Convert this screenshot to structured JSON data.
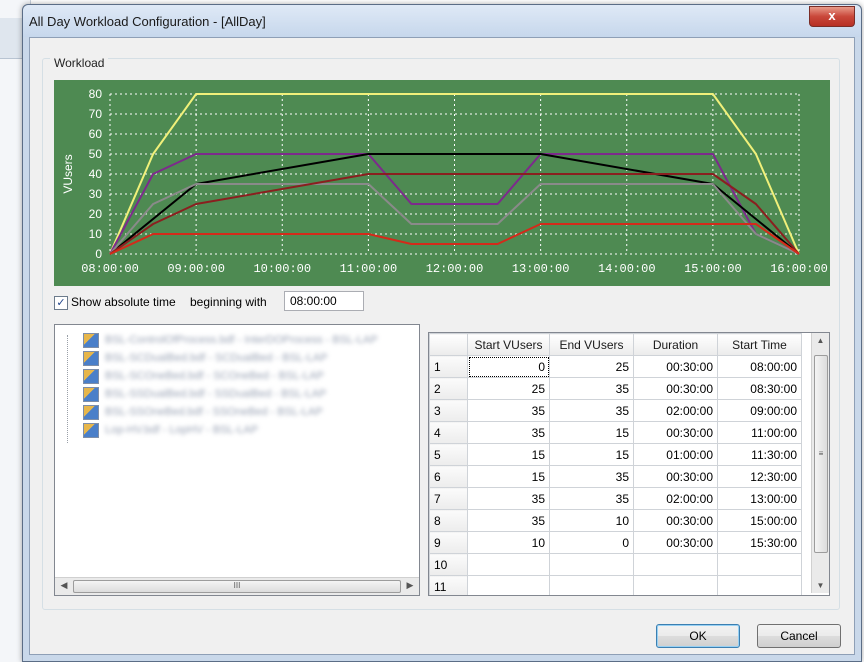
{
  "window": {
    "title": "All Day Workload Configuration - [AllDay]",
    "close_glyph": "x"
  },
  "workload": {
    "group_label": "Workload",
    "show_absolute_time_label_part1": "Show absolute time",
    "show_absolute_time_label_part2": "beginning with",
    "show_absolute_time_checked": true,
    "start_time_value": "08:00:00"
  },
  "chart_data": {
    "type": "line",
    "ylabel": "VUsers",
    "xlabel": "",
    "ylim": [
      0,
      80
    ],
    "y_ticks": [
      "0",
      "10",
      "20",
      "30",
      "40",
      "50",
      "60",
      "70",
      "80"
    ],
    "x_tick_labels": [
      "08:00:00",
      "09:00:00",
      "10:00:00",
      "11:00:00",
      "12:00:00",
      "13:00:00",
      "14:00:00",
      "15:00:00",
      "16:00:00"
    ],
    "x_range_hours": [
      8,
      16
    ],
    "grid": true,
    "background_color": "#4e8a52",
    "series": [
      {
        "color": "#f0f07a",
        "x": [
          8,
          8.5,
          9,
          15,
          15.5,
          16
        ],
        "y": [
          0,
          50,
          80,
          80,
          50,
          0
        ]
      },
      {
        "color": "#7d2a8c",
        "x": [
          8,
          8.5,
          9,
          11,
          11.5,
          12.5,
          13,
          15,
          15.5,
          16
        ],
        "y": [
          0,
          40,
          50,
          50,
          25,
          25,
          50,
          50,
          10,
          0
        ]
      },
      {
        "color": "#000000",
        "x": [
          8,
          9,
          11,
          13,
          15,
          16
        ],
        "y": [
          0,
          35,
          50,
          50,
          35,
          0
        ]
      },
      {
        "color": "#8a8a8a",
        "x": [
          8,
          8.5,
          9,
          11,
          11.5,
          12.5,
          13,
          15,
          15.5,
          16
        ],
        "y": [
          0,
          25,
          35,
          35,
          15,
          15,
          35,
          35,
          10,
          0
        ]
      },
      {
        "color": "#8a1f1f",
        "x": [
          8,
          8.5,
          9,
          11,
          15,
          15.5,
          16
        ],
        "y": [
          0,
          15,
          25,
          40,
          40,
          25,
          0
        ]
      },
      {
        "color": "#d42a1a",
        "x": [
          8,
          8.5,
          11,
          11.5,
          12.5,
          13,
          15,
          15.5,
          16
        ],
        "y": [
          0,
          10,
          10,
          5,
          5,
          15,
          15,
          15,
          0
        ]
      }
    ]
  },
  "tree": {
    "items": [
      {
        "label": "BSL-ControlOfProcess.bdf - InterDOProcess - BSL-LAP"
      },
      {
        "label": "BSL-SCDualBed.bdf - SCDualBed - BSL-LAP"
      },
      {
        "label": "BSL-SCOneBed.bdf - SCOneBed - BSL-LAP"
      },
      {
        "label": "BSL-SSDualBed.bdf - SSDualBed - BSL-LAP"
      },
      {
        "label": "BSL-SSOneBed.bdf - SSOneBed - BSL-LAP"
      },
      {
        "label": "Lop-HV.bdf - LopHV - BSL-LAP"
      }
    ],
    "scroll_grip": "III"
  },
  "table": {
    "columns": [
      "",
      "Start VUsers",
      "End VUsers",
      "Duration",
      "Start Time"
    ],
    "rows": [
      {
        "n": "1",
        "start": "0",
        "end": "25",
        "duration": "00:30:00",
        "time": "08:00:00"
      },
      {
        "n": "2",
        "start": "25",
        "end": "35",
        "duration": "00:30:00",
        "time": "08:30:00"
      },
      {
        "n": "3",
        "start": "35",
        "end": "35",
        "duration": "02:00:00",
        "time": "09:00:00"
      },
      {
        "n": "4",
        "start": "35",
        "end": "15",
        "duration": "00:30:00",
        "time": "11:00:00"
      },
      {
        "n": "5",
        "start": "15",
        "end": "15",
        "duration": "01:00:00",
        "time": "11:30:00"
      },
      {
        "n": "6",
        "start": "15",
        "end": "35",
        "duration": "00:30:00",
        "time": "12:30:00"
      },
      {
        "n": "7",
        "start": "35",
        "end": "35",
        "duration": "02:00:00",
        "time": "13:00:00"
      },
      {
        "n": "8",
        "start": "35",
        "end": "10",
        "duration": "00:30:00",
        "time": "15:00:00"
      },
      {
        "n": "9",
        "start": "10",
        "end": "0",
        "duration": "00:30:00",
        "time": "15:30:00"
      },
      {
        "n": "10",
        "start": "",
        "end": "",
        "duration": "",
        "time": ""
      },
      {
        "n": "11",
        "start": "",
        "end": "",
        "duration": "",
        "time": ""
      }
    ],
    "scroll_grip": "≡"
  },
  "buttons": {
    "ok": "OK",
    "cancel": "Cancel"
  }
}
